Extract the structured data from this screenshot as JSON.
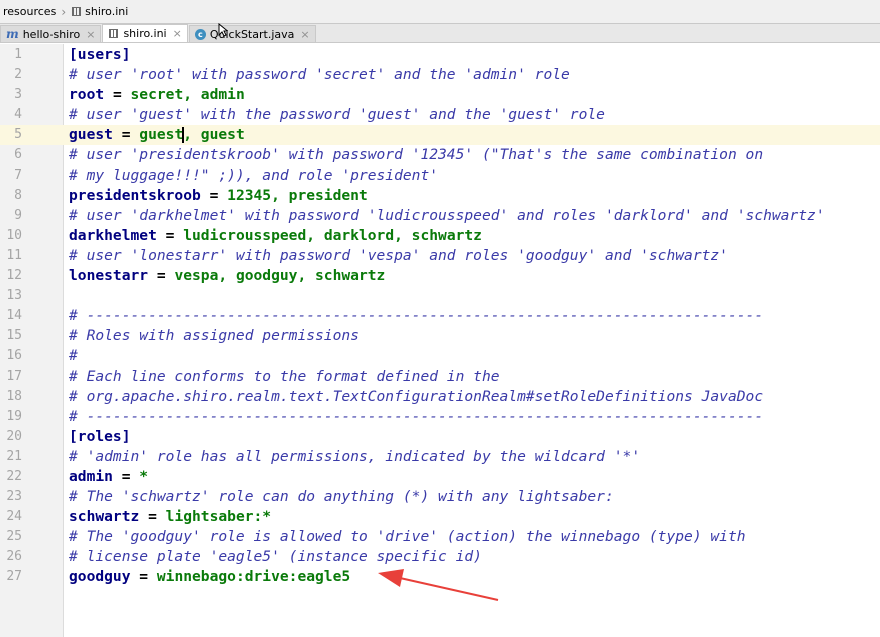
{
  "breadcrumb": {
    "items": [
      "resources",
      "shiro.ini"
    ]
  },
  "tabs": [
    {
      "label": "hello-shiro",
      "icon": "maven-module-icon",
      "active": false
    },
    {
      "label": "shiro.ini",
      "icon": "ini-file-icon",
      "active": true
    },
    {
      "label": "QuickStart.java",
      "icon": "java-class-icon",
      "active": false
    }
  ],
  "editor": {
    "current_line": 5,
    "lines": [
      {
        "n": "1",
        "segs": [
          [
            "sec",
            "[users]"
          ]
        ]
      },
      {
        "n": "2",
        "segs": [
          [
            "cmt",
            "# user 'root' with password 'secret' and the 'admin' role"
          ]
        ]
      },
      {
        "n": "3",
        "segs": [
          [
            "key",
            "root"
          ],
          [
            "eq",
            " = "
          ],
          [
            "val",
            "secret, admin"
          ]
        ]
      },
      {
        "n": "4",
        "segs": [
          [
            "cmt",
            "# user 'guest' with the password 'guest' and the 'guest' role"
          ]
        ]
      },
      {
        "n": "5",
        "segs": [
          [
            "key",
            "guest"
          ],
          [
            "eq",
            " = "
          ],
          [
            "val",
            "guest"
          ],
          [
            "caret",
            ""
          ],
          [
            "val",
            ", guest"
          ]
        ]
      },
      {
        "n": "6",
        "segs": [
          [
            "cmt",
            "# user 'presidentskroob' with password '12345' (\"That's the same combination on"
          ]
        ]
      },
      {
        "n": "7",
        "segs": [
          [
            "cmt",
            "# my luggage!!!\" ;)), and role 'president'"
          ]
        ]
      },
      {
        "n": "8",
        "segs": [
          [
            "key",
            "presidentskroob"
          ],
          [
            "eq",
            " = "
          ],
          [
            "val",
            "12345, president"
          ]
        ]
      },
      {
        "n": "9",
        "segs": [
          [
            "cmt",
            "# user 'darkhelmet' with password 'ludicrousspeed' and roles 'darklord' and 'schwartz'"
          ]
        ]
      },
      {
        "n": "10",
        "segs": [
          [
            "key",
            "darkhelmet"
          ],
          [
            "eq",
            " = "
          ],
          [
            "val",
            "ludicrousspeed, darklord, schwartz"
          ]
        ]
      },
      {
        "n": "11",
        "segs": [
          [
            "cmt",
            "# user 'lonestarr' with password 'vespa' and roles 'goodguy' and 'schwartz'"
          ]
        ]
      },
      {
        "n": "12",
        "segs": [
          [
            "key",
            "lonestarr"
          ],
          [
            "eq",
            " = "
          ],
          [
            "val",
            "vespa, goodguy, schwartz"
          ]
        ]
      },
      {
        "n": "13",
        "segs": []
      },
      {
        "n": "14",
        "segs": [
          [
            "cmt",
            "# -----------------------------------------------------------------------------"
          ]
        ]
      },
      {
        "n": "15",
        "segs": [
          [
            "cmt",
            "# Roles with assigned permissions"
          ]
        ]
      },
      {
        "n": "16",
        "segs": [
          [
            "cmt",
            "#"
          ]
        ]
      },
      {
        "n": "17",
        "segs": [
          [
            "cmt",
            "# Each line conforms to the format defined in the"
          ]
        ]
      },
      {
        "n": "18",
        "segs": [
          [
            "cmt",
            "# org.apache.shiro.realm.text.TextConfigurationRealm#setRoleDefinitions JavaDoc"
          ]
        ]
      },
      {
        "n": "19",
        "segs": [
          [
            "cmt",
            "# -----------------------------------------------------------------------------"
          ]
        ]
      },
      {
        "n": "20",
        "segs": [
          [
            "sec",
            "[roles]"
          ]
        ]
      },
      {
        "n": "21",
        "segs": [
          [
            "cmt",
            "# 'admin' role has all permissions, indicated by the wildcard '*'"
          ]
        ]
      },
      {
        "n": "22",
        "segs": [
          [
            "key",
            "admin"
          ],
          [
            "eq",
            " = "
          ],
          [
            "val",
            "*"
          ]
        ]
      },
      {
        "n": "23",
        "segs": [
          [
            "cmt",
            "# The 'schwartz' role can do anything (*) with any lightsaber:"
          ]
        ]
      },
      {
        "n": "24",
        "segs": [
          [
            "key",
            "schwartz"
          ],
          [
            "eq",
            " = "
          ],
          [
            "val",
            "lightsaber:*"
          ]
        ]
      },
      {
        "n": "25",
        "segs": [
          [
            "cmt",
            "# The 'goodguy' role is allowed to 'drive' (action) the winnebago (type) with"
          ]
        ]
      },
      {
        "n": "26",
        "segs": [
          [
            "cmt",
            "# license plate 'eagle5' (instance specific id)"
          ]
        ]
      },
      {
        "n": "27",
        "segs": [
          [
            "key",
            "goodguy"
          ],
          [
            "eq",
            " = "
          ],
          [
            "val",
            "winnebago:drive:eagle5"
          ]
        ]
      }
    ]
  },
  "annotation": {
    "type": "red-arrow",
    "points_to_line": 27,
    "color": "#e8403a"
  },
  "colors": {
    "comment": "#3a3aa8",
    "key": "#00007f",
    "value": "#0a7a0a",
    "current_line_bg": "#fcf8e0",
    "gutter_bg": "#f2f2f2"
  }
}
